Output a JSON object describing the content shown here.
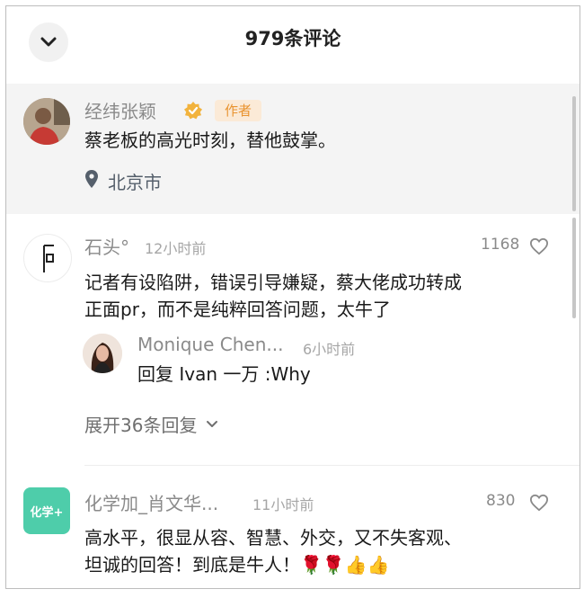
{
  "header": {
    "title": "979条评论"
  },
  "author_comment": {
    "username": "经纬张颖",
    "badge": "作者",
    "text": "蔡老板的高光时刻，替他鼓掌。",
    "location": "北京市"
  },
  "comments": [
    {
      "username": "石头°",
      "time": "12小时前",
      "likes": "1168",
      "lines": [
        "记者有设陷阱，错误引导嫌疑，蔡大佬成功转成",
        "正面pr，而不是纯粹回答问题，太牛了"
      ],
      "reply": {
        "username": "Monique Chen...",
        "time": "6小时前",
        "text": "回复 Ivan 一万 :Why"
      },
      "expand_label": "展开36条回复"
    },
    {
      "username": "化学加_肖文华...",
      "time": "11小时前",
      "likes": "830",
      "lines": [
        "高水平，很显从容、智慧、外交，又不失客观、",
        "坦诚的回答！到底是牛人！🌹🌹👍👍"
      ],
      "avatar_text": "化学+"
    }
  ],
  "colors": {
    "badge_bg": "#fbead7",
    "badge_text": "#e9932f",
    "verified": "#f2b33d",
    "logo_green": "#4ecdaa"
  },
  "icons": {
    "back": "chevron-down-icon",
    "verified": "verified-badge-icon",
    "location": "location-pin-icon",
    "like": "heart-icon",
    "expand": "chevron-down-icon"
  }
}
